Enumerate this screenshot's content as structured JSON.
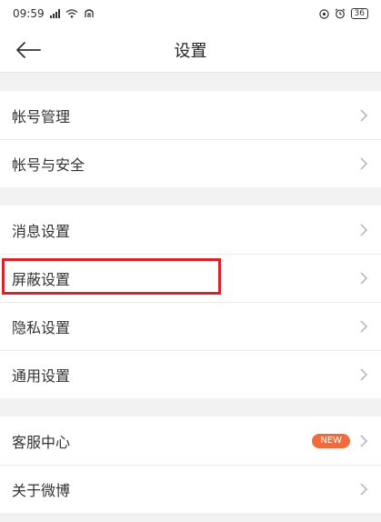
{
  "status_bar": {
    "time": "09:59",
    "battery": "36"
  },
  "header": {
    "title": "设置"
  },
  "groups": [
    {
      "items": [
        {
          "label": "帐号管理"
        },
        {
          "label": "帐号与安全"
        }
      ]
    },
    {
      "items": [
        {
          "label": "消息设置"
        },
        {
          "label": "屏蔽设置"
        },
        {
          "label": "隐私设置"
        },
        {
          "label": "通用设置"
        }
      ]
    },
    {
      "items": [
        {
          "label": "客服中心",
          "badge": "NEW"
        },
        {
          "label": "关于微博"
        }
      ]
    }
  ],
  "colors": {
    "highlight": "#d9232a",
    "badge": "#f26b3a"
  }
}
